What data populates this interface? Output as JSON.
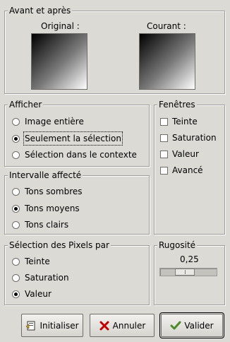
{
  "before_after": {
    "title": "Avant et après",
    "original_label": "Original :",
    "current_label": "Courant :"
  },
  "afficher": {
    "title": "Afficher",
    "options": [
      "Image entière",
      "Seulement la sélection",
      "Sélection dans le contexte"
    ],
    "selected": 1
  },
  "fenetres": {
    "title": "Fenêtres",
    "options": [
      "Teinte",
      "Saturation",
      "Valeur",
      "Avancé"
    ],
    "checked": [
      false,
      false,
      false,
      false
    ]
  },
  "intervalle": {
    "title": "Intervalle affecté",
    "options": [
      "Tons sombres",
      "Tons moyens",
      "Tons clairs"
    ],
    "selected": 1
  },
  "selection_pixels": {
    "title": "Sélection des Pixels par",
    "options": [
      "Teinte",
      "Saturation",
      "Valeur"
    ],
    "selected": 2
  },
  "rugosite": {
    "title": "Rugosité",
    "value": "0,25"
  },
  "buttons": {
    "reset": "Initialiser",
    "cancel": "Annuler",
    "ok": "Valider"
  },
  "colors": {
    "background": "#dcdad5",
    "cancel_icon": "#c00000",
    "ok_icon": "#4a8a2a"
  },
  "icons": {
    "reset": "reset-icon",
    "cancel": "cancel-x-icon",
    "ok": "check-icon"
  }
}
